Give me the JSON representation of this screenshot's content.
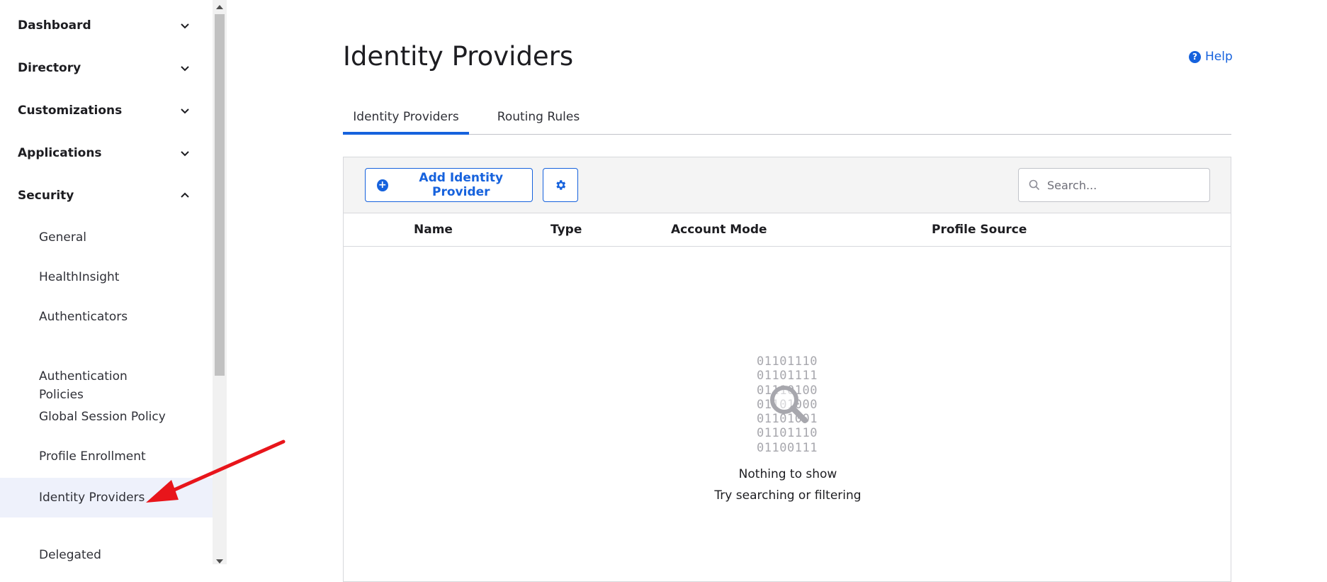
{
  "sidebar": {
    "groups": [
      {
        "label": "Dashboard",
        "expanded": false
      },
      {
        "label": "Directory",
        "expanded": false
      },
      {
        "label": "Customizations",
        "expanded": false
      },
      {
        "label": "Applications",
        "expanded": false
      },
      {
        "label": "Security",
        "expanded": true
      }
    ],
    "security_items": [
      {
        "label": "General"
      },
      {
        "label": "HealthInsight"
      },
      {
        "label": "Authenticators"
      },
      {
        "label": "Authentication\nPolicies"
      },
      {
        "label": "Global Session Policy"
      },
      {
        "label": "Profile Enrollment"
      },
      {
        "label": "Identity Providers",
        "active": true
      },
      {
        "label": "Delegated\nAuthentication"
      }
    ]
  },
  "header": {
    "title": "Identity Providers",
    "help_label": "Help"
  },
  "tabs": [
    {
      "label": "Identity Providers",
      "active": true
    },
    {
      "label": "Routing Rules",
      "active": false
    }
  ],
  "toolbar": {
    "add_label": "Add Identity Provider",
    "settings_icon": "gear-icon",
    "search_placeholder": "Search..."
  },
  "table": {
    "columns": [
      "Name",
      "Type",
      "Account Mode",
      "Profile Source"
    ]
  },
  "empty_state": {
    "binary_lines": [
      "01101110",
      "01101111",
      "01110100",
      "01101000",
      "01101001",
      "01101110",
      "01100111"
    ],
    "title": "Nothing to show",
    "subtitle": "Try searching or filtering"
  },
  "colors": {
    "accent": "#1662dd",
    "active_nav_bg": "#eef1fb",
    "annotation": "#e8151b"
  }
}
